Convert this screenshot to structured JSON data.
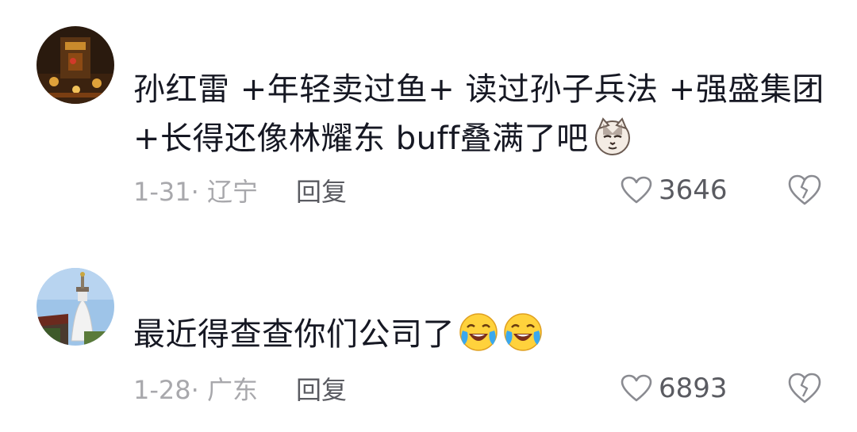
{
  "comments": [
    {
      "avatar_icon": "avatar-temple-night",
      "text": "孙红雷 +年轻卖过鱼+  读过孙子兵法  +强盛集团 +长得还像林耀东  buff叠满了吧",
      "emoji_icon": "cat-face-emoji",
      "date_location": "1-31· 辽宁",
      "reply_label": "回复",
      "like_count": "3646"
    },
    {
      "avatar_icon": "avatar-white-pagoda",
      "text": "最近得查查你们公司了",
      "emoji_icon": "crying-laughing-emoji",
      "date_location": "1-28· 广东",
      "reply_label": "回复",
      "like_count": "6893"
    }
  ],
  "colors": {
    "text": "#161823",
    "meta": "#a8a8ac",
    "action": "#5a5b61",
    "background": "#ffffff"
  }
}
